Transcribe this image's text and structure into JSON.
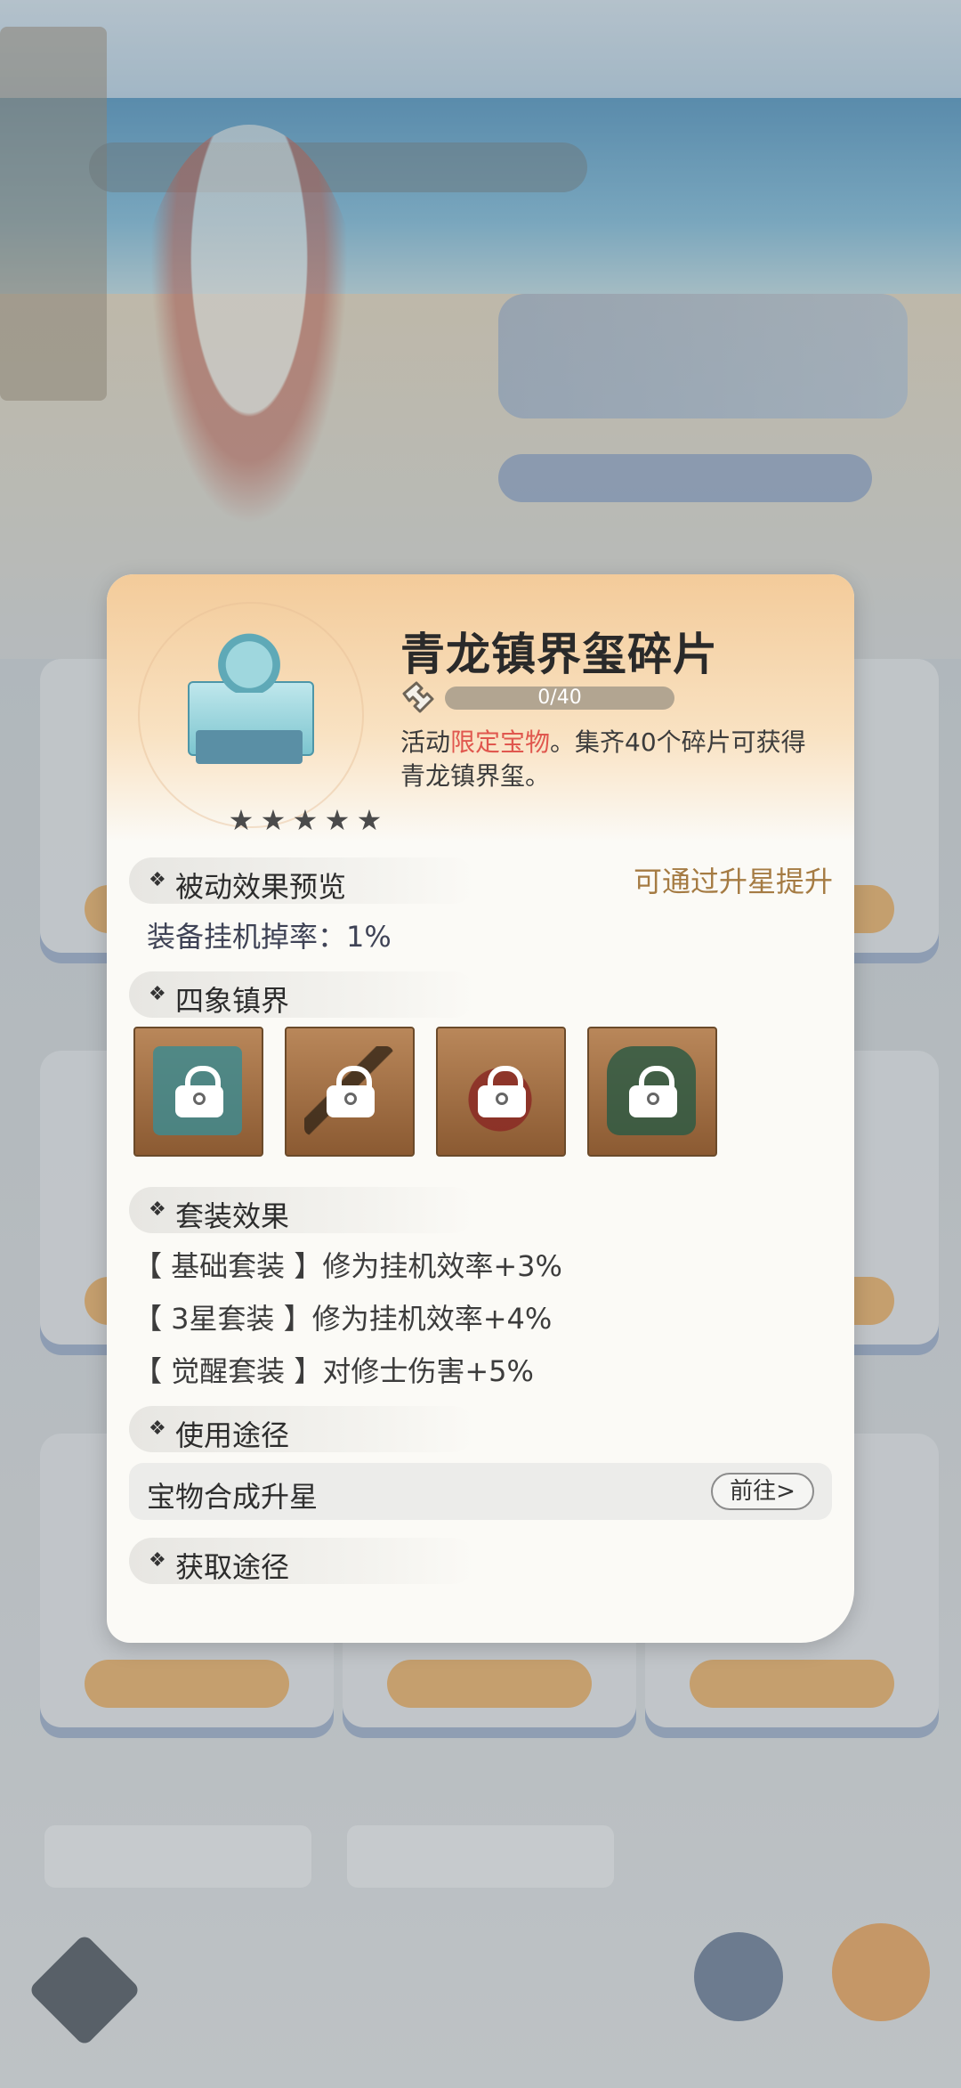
{
  "item": {
    "title": "青龙镇界玺碎片",
    "stars": 5,
    "progress_text": "0/40",
    "progress_fraction": 0.0,
    "desc_prefix": "活动",
    "desc_highlight": "限定宝物",
    "desc_rest": "。集齐40个碎片可获得青龙镇界玺。"
  },
  "passive": {
    "heading": "被动效果预览",
    "note": "可通过升星提升",
    "stat": "装备挂机掉率：1%"
  },
  "four_symbols": {
    "heading": "四象镇界",
    "items": [
      "seal",
      "sword",
      "fan",
      "armor"
    ]
  },
  "set_effect": {
    "heading": "套装效果",
    "lines": [
      "【 基础套装 】修为挂机效率+3%",
      "【 3星套装 】修为挂机效率+4%",
      "【 觉醒套装 】对修士伤害+5%"
    ]
  },
  "usage": {
    "heading": "使用途径",
    "row_label": "宝物合成升星",
    "goto_label": "前往>"
  },
  "obtain": {
    "heading": "获取途径"
  },
  "colors": {
    "highlight": "#e0574e",
    "note": "#a57b43",
    "header_bg": "#f3cb9a"
  }
}
